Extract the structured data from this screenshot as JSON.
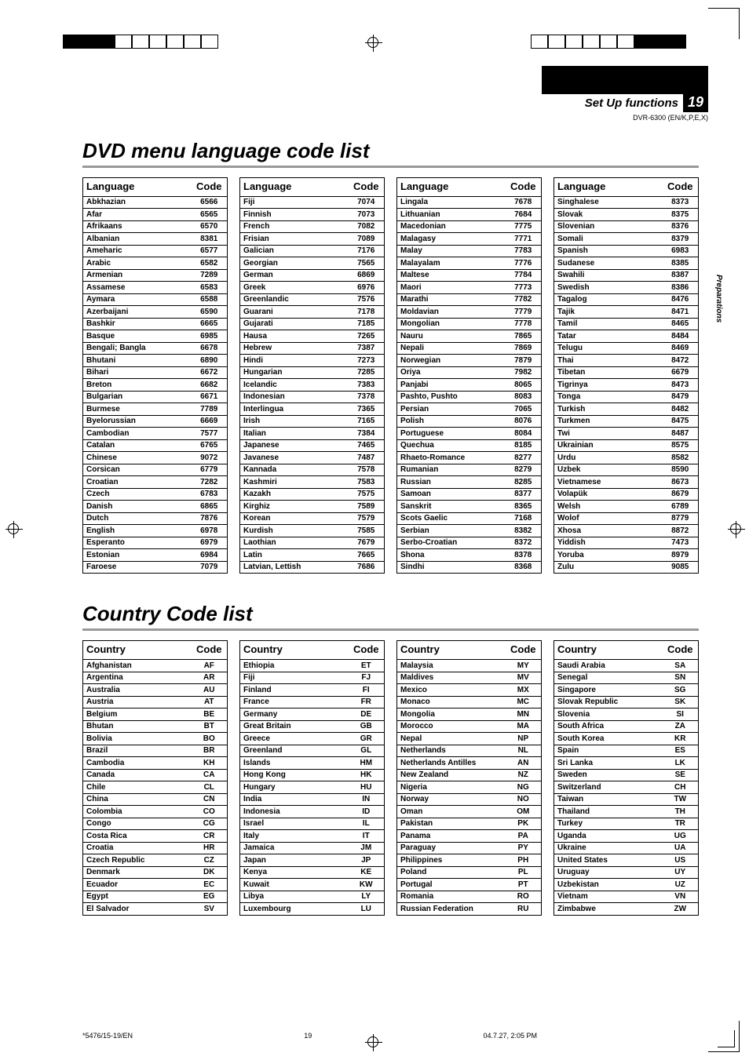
{
  "header": {
    "section_label": "Set Up functions",
    "page_number": "19",
    "model": "DVR-6300 (EN/K,P,E,X)"
  },
  "side_tab": "Preparations",
  "lang_section": {
    "title": "DVD menu language code list",
    "col_headers": {
      "name": "Language",
      "code": "Code"
    },
    "columns": [
      [
        {
          "n": "Abkhazian",
          "c": "6566"
        },
        {
          "n": "Afar",
          "c": "6565"
        },
        {
          "n": "Afrikaans",
          "c": "6570"
        },
        {
          "n": "Albanian",
          "c": "8381"
        },
        {
          "n": "Ameharic",
          "c": "6577"
        },
        {
          "n": "Arabic",
          "c": "6582"
        },
        {
          "n": "Armenian",
          "c": "7289"
        },
        {
          "n": "Assamese",
          "c": "6583"
        },
        {
          "n": "Aymara",
          "c": "6588"
        },
        {
          "n": "Azerbaijani",
          "c": "6590"
        },
        {
          "n": "Bashkir",
          "c": "6665"
        },
        {
          "n": "Basque",
          "c": "6985"
        },
        {
          "n": "Bengali; Bangla",
          "c": "6678"
        },
        {
          "n": "Bhutani",
          "c": "6890"
        },
        {
          "n": "Bihari",
          "c": "6672"
        },
        {
          "n": "Breton",
          "c": "6682"
        },
        {
          "n": "Bulgarian",
          "c": "6671"
        },
        {
          "n": "Burmese",
          "c": "7789"
        },
        {
          "n": "Byelorussian",
          "c": "6669"
        },
        {
          "n": "Cambodian",
          "c": "7577"
        },
        {
          "n": "Catalan",
          "c": "6765"
        },
        {
          "n": "Chinese",
          "c": "9072"
        },
        {
          "n": "Corsican",
          "c": "6779"
        },
        {
          "n": "Croatian",
          "c": "7282"
        },
        {
          "n": "Czech",
          "c": "6783"
        },
        {
          "n": "Danish",
          "c": "6865"
        },
        {
          "n": "Dutch",
          "c": "7876"
        },
        {
          "n": "English",
          "c": "6978"
        },
        {
          "n": "Esperanto",
          "c": "6979"
        },
        {
          "n": "Estonian",
          "c": "6984"
        },
        {
          "n": "Faroese",
          "c": "7079"
        }
      ],
      [
        {
          "n": "Fiji",
          "c": "7074"
        },
        {
          "n": "Finnish",
          "c": "7073"
        },
        {
          "n": "French",
          "c": "7082"
        },
        {
          "n": "Frisian",
          "c": "7089"
        },
        {
          "n": "Galician",
          "c": "7176"
        },
        {
          "n": "Georgian",
          "c": "7565"
        },
        {
          "n": "German",
          "c": "6869"
        },
        {
          "n": "Greek",
          "c": "6976"
        },
        {
          "n": "Greenlandic",
          "c": "7576"
        },
        {
          "n": "Guarani",
          "c": "7178"
        },
        {
          "n": "Gujarati",
          "c": "7185"
        },
        {
          "n": "Hausa",
          "c": "7265"
        },
        {
          "n": "Hebrew",
          "c": "7387"
        },
        {
          "n": "Hindi",
          "c": "7273"
        },
        {
          "n": "Hungarian",
          "c": "7285"
        },
        {
          "n": "Icelandic",
          "c": "7383"
        },
        {
          "n": "Indonesian",
          "c": "7378"
        },
        {
          "n": "Interlingua",
          "c": "7365"
        },
        {
          "n": "Irish",
          "c": "7165"
        },
        {
          "n": "Italian",
          "c": "7384"
        },
        {
          "n": "Japanese",
          "c": "7465"
        },
        {
          "n": "Javanese",
          "c": "7487"
        },
        {
          "n": "Kannada",
          "c": "7578"
        },
        {
          "n": "Kashmiri",
          "c": "7583"
        },
        {
          "n": "Kazakh",
          "c": "7575"
        },
        {
          "n": "Kirghiz",
          "c": "7589"
        },
        {
          "n": "Korean",
          "c": "7579"
        },
        {
          "n": "Kurdish",
          "c": "7585"
        },
        {
          "n": "Laothian",
          "c": "7679"
        },
        {
          "n": "Latin",
          "c": "7665"
        },
        {
          "n": "Latvian, Lettish",
          "c": "7686"
        }
      ],
      [
        {
          "n": "Lingala",
          "c": "7678"
        },
        {
          "n": "Lithuanian",
          "c": "7684"
        },
        {
          "n": "Macedonian",
          "c": "7775"
        },
        {
          "n": "Malagasy",
          "c": "7771"
        },
        {
          "n": "Malay",
          "c": "7783"
        },
        {
          "n": "Malayalam",
          "c": "7776"
        },
        {
          "n": "Maltese",
          "c": "7784"
        },
        {
          "n": "Maori",
          "c": "7773"
        },
        {
          "n": "Marathi",
          "c": "7782"
        },
        {
          "n": "Moldavian",
          "c": "7779"
        },
        {
          "n": "Mongolian",
          "c": "7778"
        },
        {
          "n": "Nauru",
          "c": "7865"
        },
        {
          "n": "Nepali",
          "c": "7869"
        },
        {
          "n": "Norwegian",
          "c": "7879"
        },
        {
          "n": "Oriya",
          "c": "7982"
        },
        {
          "n": "Panjabi",
          "c": "8065"
        },
        {
          "n": "Pashto, Pushto",
          "c": "8083"
        },
        {
          "n": "Persian",
          "c": "7065"
        },
        {
          "n": "Polish",
          "c": "8076"
        },
        {
          "n": "Portuguese",
          "c": "8084"
        },
        {
          "n": "Quechua",
          "c": "8185"
        },
        {
          "n": "Rhaeto-Romance",
          "c": "8277"
        },
        {
          "n": "Rumanian",
          "c": "8279"
        },
        {
          "n": "Russian",
          "c": "8285"
        },
        {
          "n": "Samoan",
          "c": "8377"
        },
        {
          "n": "Sanskrit",
          "c": "8365"
        },
        {
          "n": "Scots Gaelic",
          "c": "7168"
        },
        {
          "n": "Serbian",
          "c": "8382"
        },
        {
          "n": "Serbo-Croatian",
          "c": "8372"
        },
        {
          "n": "Shona",
          "c": "8378"
        },
        {
          "n": "Sindhi",
          "c": "8368"
        }
      ],
      [
        {
          "n": "Singhalese",
          "c": "8373"
        },
        {
          "n": "Slovak",
          "c": "8375"
        },
        {
          "n": "Slovenian",
          "c": "8376"
        },
        {
          "n": "Somali",
          "c": "8379"
        },
        {
          "n": "Spanish",
          "c": "6983"
        },
        {
          "n": "Sudanese",
          "c": "8385"
        },
        {
          "n": "Swahili",
          "c": "8387"
        },
        {
          "n": "Swedish",
          "c": "8386"
        },
        {
          "n": "Tagalog",
          "c": "8476"
        },
        {
          "n": "Tajik",
          "c": "8471"
        },
        {
          "n": "Tamil",
          "c": "8465"
        },
        {
          "n": "Tatar",
          "c": "8484"
        },
        {
          "n": "Telugu",
          "c": "8469"
        },
        {
          "n": "Thai",
          "c": "8472"
        },
        {
          "n": "Tibetan",
          "c": "6679"
        },
        {
          "n": "Tigrinya",
          "c": "8473"
        },
        {
          "n": "Tonga",
          "c": "8479"
        },
        {
          "n": "Turkish",
          "c": "8482"
        },
        {
          "n": "Turkmen",
          "c": "8475"
        },
        {
          "n": "Twi",
          "c": "8487"
        },
        {
          "n": "Ukrainian",
          "c": "8575"
        },
        {
          "n": "Urdu",
          "c": "8582"
        },
        {
          "n": "Uzbek",
          "c": "8590"
        },
        {
          "n": "Vietnamese",
          "c": "8673"
        },
        {
          "n": "Volapük",
          "c": "8679"
        },
        {
          "n": "Welsh",
          "c": "6789"
        },
        {
          "n": "Wolof",
          "c": "8779"
        },
        {
          "n": "Xhosa",
          "c": "8872"
        },
        {
          "n": "Yiddish",
          "c": "7473"
        },
        {
          "n": "Yoruba",
          "c": "8979"
        },
        {
          "n": "Zulu",
          "c": "9085"
        }
      ]
    ]
  },
  "country_section": {
    "title": "Country Code list",
    "col_headers": {
      "name": "Country",
      "code": "Code"
    },
    "columns": [
      [
        {
          "n": "Afghanistan",
          "c": "AF"
        },
        {
          "n": "Argentina",
          "c": "AR"
        },
        {
          "n": "Australia",
          "c": "AU"
        },
        {
          "n": "Austria",
          "c": "AT"
        },
        {
          "n": "Belgium",
          "c": "BE"
        },
        {
          "n": "Bhutan",
          "c": "BT"
        },
        {
          "n": "Bolivia",
          "c": "BO"
        },
        {
          "n": "Brazil",
          "c": "BR"
        },
        {
          "n": "Cambodia",
          "c": "KH"
        },
        {
          "n": "Canada",
          "c": "CA"
        },
        {
          "n": "Chile",
          "c": "CL"
        },
        {
          "n": "China",
          "c": "CN"
        },
        {
          "n": "Colombia",
          "c": "CO"
        },
        {
          "n": "Congo",
          "c": "CG"
        },
        {
          "n": "Costa Rica",
          "c": "CR"
        },
        {
          "n": "Croatia",
          "c": "HR"
        },
        {
          "n": "Czech Republic",
          "c": "CZ"
        },
        {
          "n": "Denmark",
          "c": "DK"
        },
        {
          "n": "Ecuador",
          "c": "EC"
        },
        {
          "n": "Egypt",
          "c": "EG"
        },
        {
          "n": "El Salvador",
          "c": "SV"
        }
      ],
      [
        {
          "n": "Ethiopia",
          "c": "ET"
        },
        {
          "n": "Fiji",
          "c": "FJ"
        },
        {
          "n": "Finland",
          "c": "FI"
        },
        {
          "n": "France",
          "c": "FR"
        },
        {
          "n": "Germany",
          "c": "DE"
        },
        {
          "n": "Great Britain",
          "c": "GB"
        },
        {
          "n": "Greece",
          "c": "GR"
        },
        {
          "n": "Greenland",
          "c": "GL"
        },
        {
          "n": "Islands",
          "c": "HM"
        },
        {
          "n": "Hong Kong",
          "c": "HK"
        },
        {
          "n": "Hungary",
          "c": "HU"
        },
        {
          "n": "India",
          "c": "IN"
        },
        {
          "n": "Indonesia",
          "c": "ID"
        },
        {
          "n": "Israel",
          "c": "IL"
        },
        {
          "n": "Italy",
          "c": "IT"
        },
        {
          "n": "Jamaica",
          "c": "JM"
        },
        {
          "n": "Japan",
          "c": "JP"
        },
        {
          "n": "Kenya",
          "c": "KE"
        },
        {
          "n": "Kuwait",
          "c": "KW"
        },
        {
          "n": "Libya",
          "c": "LY"
        },
        {
          "n": "Luxembourg",
          "c": "LU"
        }
      ],
      [
        {
          "n": "Malaysia",
          "c": "MY"
        },
        {
          "n": "Maldives",
          "c": "MV"
        },
        {
          "n": "Mexico",
          "c": "MX"
        },
        {
          "n": "Monaco",
          "c": "MC"
        },
        {
          "n": "Mongolia",
          "c": "MN"
        },
        {
          "n": "Morocco",
          "c": "MA"
        },
        {
          "n": "Nepal",
          "c": "NP"
        },
        {
          "n": "Netherlands",
          "c": "NL"
        },
        {
          "n": "Netherlands Antilles",
          "c": "AN"
        },
        {
          "n": "New Zealand",
          "c": "NZ"
        },
        {
          "n": "Nigeria",
          "c": "NG"
        },
        {
          "n": "Norway",
          "c": "NO"
        },
        {
          "n": "Oman",
          "c": "OM"
        },
        {
          "n": "Pakistan",
          "c": "PK"
        },
        {
          "n": "Panama",
          "c": "PA"
        },
        {
          "n": "Paraguay",
          "c": "PY"
        },
        {
          "n": "Philippines",
          "c": "PH"
        },
        {
          "n": "Poland",
          "c": "PL"
        },
        {
          "n": "Portugal",
          "c": "PT"
        },
        {
          "n": "Romania",
          "c": "RO"
        },
        {
          "n": "Russian Federation",
          "c": "RU"
        }
      ],
      [
        {
          "n": "Saudi Arabia",
          "c": "SA"
        },
        {
          "n": "Senegal",
          "c": "SN"
        },
        {
          "n": "Singapore",
          "c": "SG"
        },
        {
          "n": "Slovak Republic",
          "c": "SK"
        },
        {
          "n": "Slovenia",
          "c": "SI"
        },
        {
          "n": "South Africa",
          "c": "ZA"
        },
        {
          "n": "South Korea",
          "c": "KR"
        },
        {
          "n": "Spain",
          "c": "ES"
        },
        {
          "n": "Sri Lanka",
          "c": "LK"
        },
        {
          "n": "Sweden",
          "c": "SE"
        },
        {
          "n": "Switzerland",
          "c": "CH"
        },
        {
          "n": "Taiwan",
          "c": "TW"
        },
        {
          "n": "Thailand",
          "c": "TH"
        },
        {
          "n": "Turkey",
          "c": "TR"
        },
        {
          "n": "Uganda",
          "c": "UG"
        },
        {
          "n": "Ukraine",
          "c": "UA"
        },
        {
          "n": "United States",
          "c": "US"
        },
        {
          "n": "Uruguay",
          "c": "UY"
        },
        {
          "n": "Uzbekistan",
          "c": "UZ"
        },
        {
          "n": "Vietnam",
          "c": "VN"
        },
        {
          "n": "Zimbabwe",
          "c": "ZW"
        }
      ]
    ]
  },
  "footer": {
    "left": "*5476/15-19/EN",
    "center": "19",
    "right": "04.7.27, 2:05 PM"
  }
}
